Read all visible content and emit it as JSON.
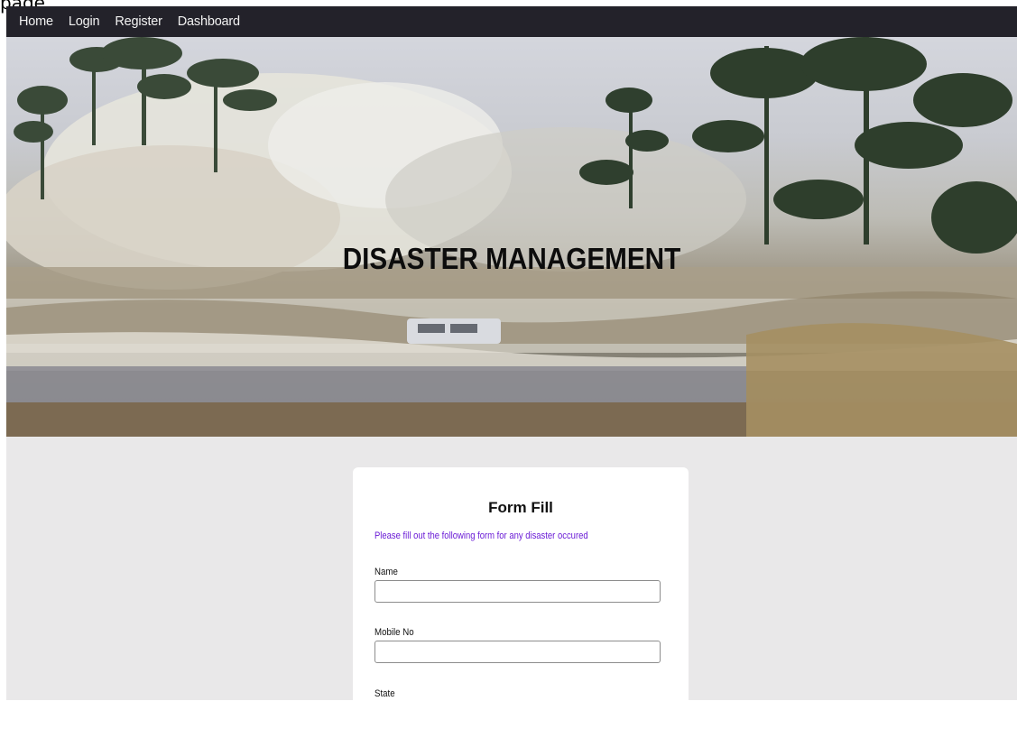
{
  "page_label": "page",
  "nav": {
    "links": [
      "Home",
      "Login",
      "Register",
      "Dashboard"
    ]
  },
  "hero": {
    "title": "DISASTER MANAGEMENT"
  },
  "form": {
    "title": "Form Fill",
    "subtitle": "Please fill out the following form for any disaster occured",
    "fields": [
      {
        "label": "Name",
        "value": ""
      },
      {
        "label": "Mobile No",
        "value": ""
      },
      {
        "label": "State",
        "value": ""
      }
    ]
  },
  "colors": {
    "navbar": "#23222a",
    "subtitle": "#6a1bd6",
    "content_bg": "#e9e8e9"
  }
}
